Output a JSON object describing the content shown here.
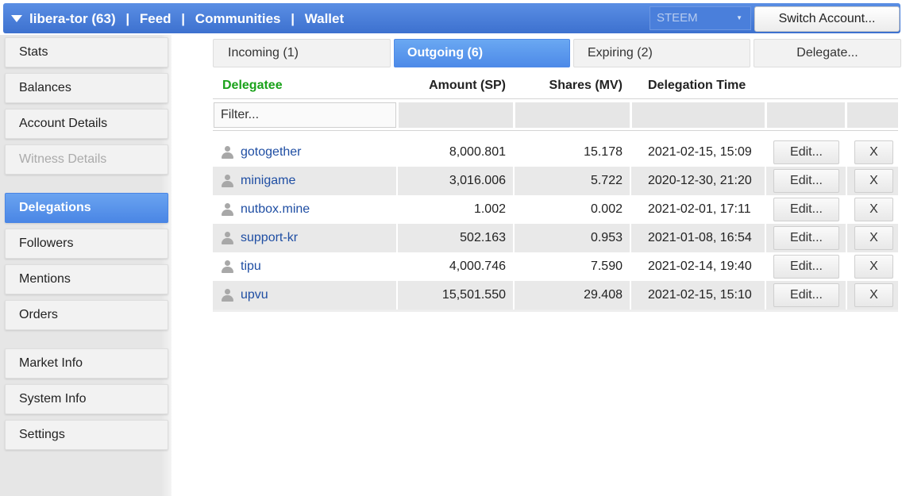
{
  "header": {
    "account": "libera-tor (63)",
    "links": [
      "Feed",
      "Communities",
      "Wallet"
    ],
    "separator": "|",
    "chain_select": "STEEM",
    "switch_label": "Switch Account..."
  },
  "sidebar": {
    "items": [
      {
        "label": "Stats"
      },
      {
        "label": "Balances"
      },
      {
        "label": "Account Details"
      },
      {
        "label": "Witness Details"
      },
      {
        "label": "Delegations"
      },
      {
        "label": "Followers"
      },
      {
        "label": "Mentions"
      },
      {
        "label": "Orders"
      },
      {
        "label": "Market Info"
      },
      {
        "label": "System Info"
      },
      {
        "label": "Settings"
      }
    ]
  },
  "tabs": {
    "incoming": "Incoming (1)",
    "outgoing": "Outgoing (6)",
    "expiring": "Expiring (2)",
    "delegate": "Delegate..."
  },
  "table": {
    "headers": {
      "delegatee": "Delegatee",
      "amount": "Amount (SP)",
      "shares": "Shares (MV)",
      "time": "Delegation Time"
    },
    "filter_placeholder": "Filter...",
    "edit_label": "Edit...",
    "delete_label": "X",
    "rows": [
      {
        "delegatee": "gotogether",
        "amount": "8,000.801",
        "shares": "15.178",
        "time": "2021-02-15, 15:09"
      },
      {
        "delegatee": "minigame",
        "amount": "3,016.006",
        "shares": "5.722",
        "time": "2020-12-30, 21:20"
      },
      {
        "delegatee": "nutbox.mine",
        "amount": "1.002",
        "shares": "0.002",
        "time": "2021-02-01, 17:11"
      },
      {
        "delegatee": "support-kr",
        "amount": "502.163",
        "shares": "0.953",
        "time": "2021-01-08, 16:54"
      },
      {
        "delegatee": "tipu",
        "amount": "4,000.746",
        "shares": "7.590",
        "time": "2021-02-14, 19:40"
      },
      {
        "delegatee": "upvu",
        "amount": "15,501.550",
        "shares": "29.408",
        "time": "2021-02-15, 15:10"
      }
    ]
  }
}
